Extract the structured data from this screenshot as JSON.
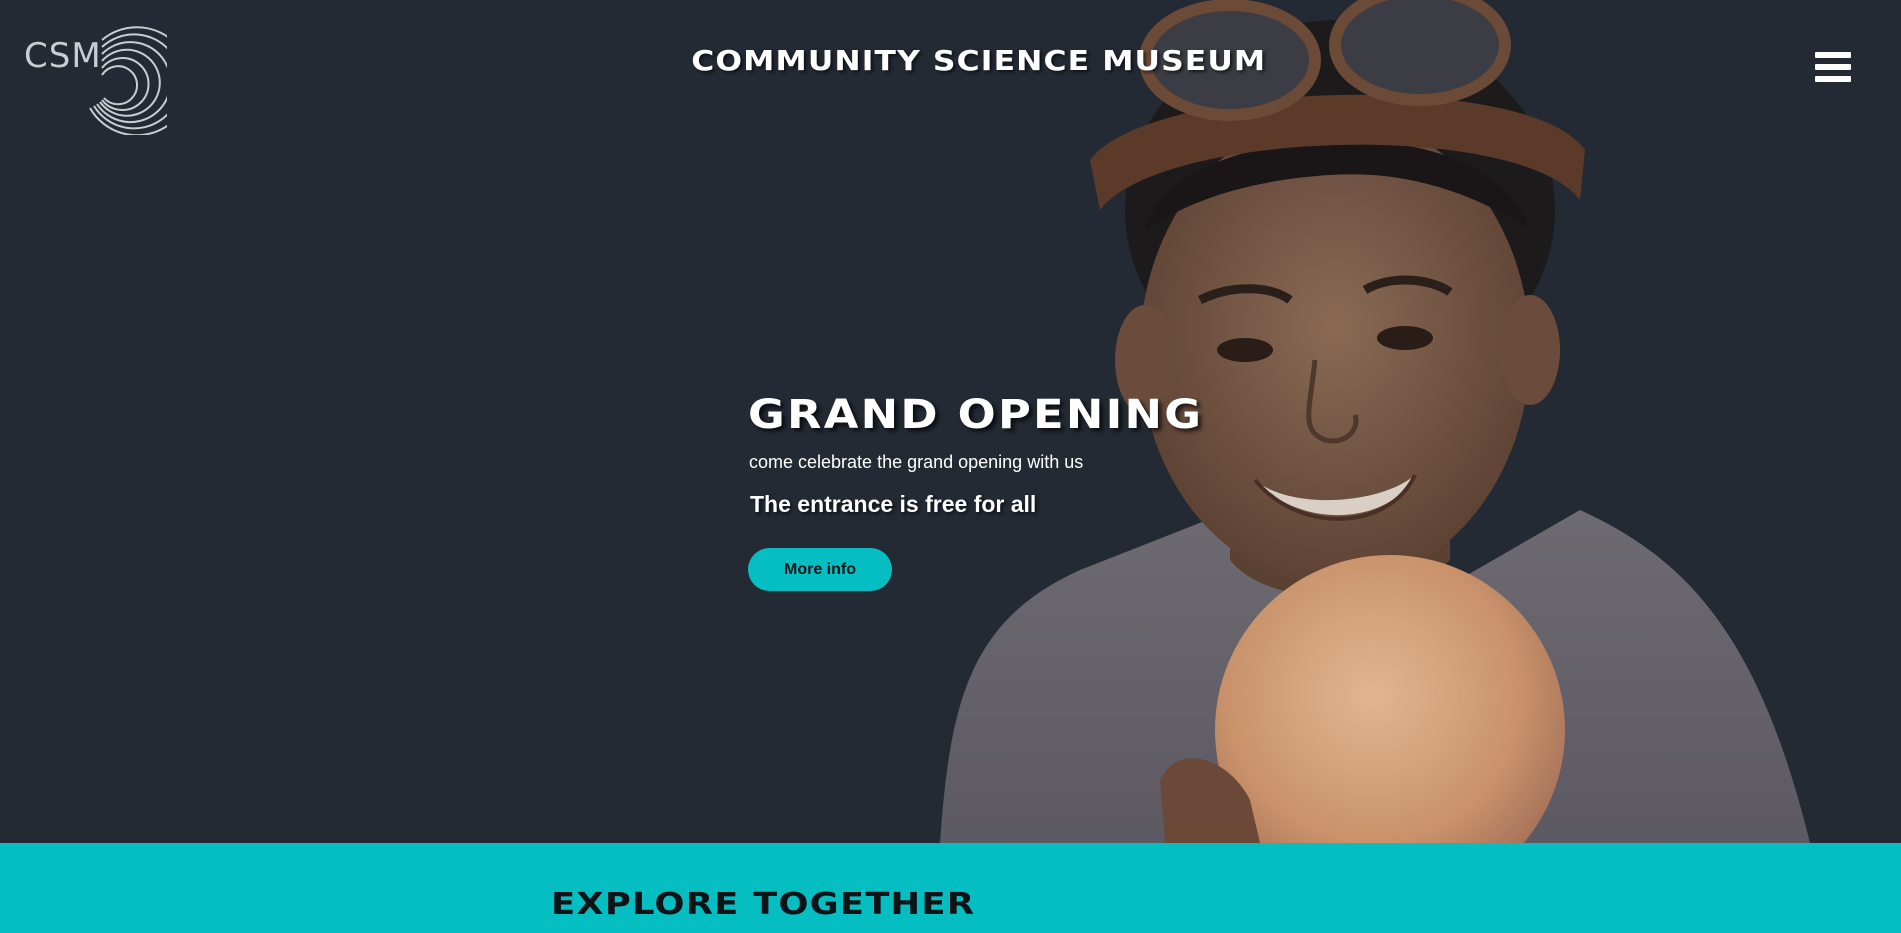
{
  "header": {
    "logo_text": "CSM",
    "site_title": "COMMUNITY SCIENCE MUSEUM",
    "menu_icon": "hamburger-menu-icon"
  },
  "hero": {
    "heading": "GRAND OPENING",
    "subheading": "come celebrate the grand opening with us",
    "highlight": "The entrance is free for all",
    "button_label": "More info",
    "image_subject": "boy with goggles holding a glowing sphere"
  },
  "section": {
    "title": "EXPLORE TOGETHER"
  },
  "colors": {
    "background": "#232a34",
    "accent": "#05bec2",
    "text_light": "#ffffff",
    "text_dark": "#0c1418"
  }
}
